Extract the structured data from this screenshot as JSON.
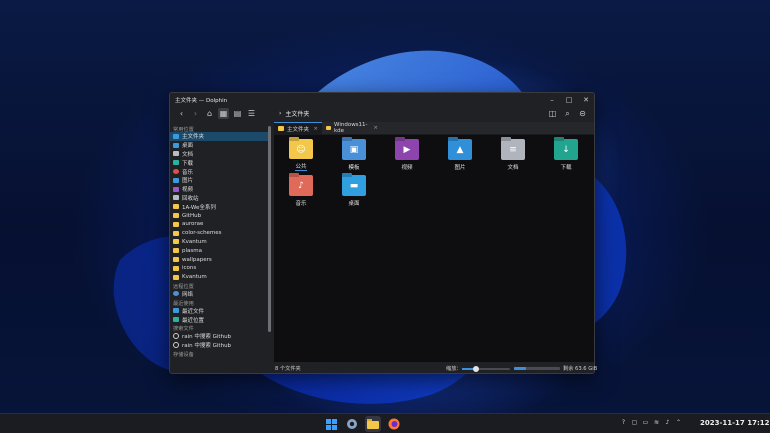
{
  "window": {
    "title": "主文件夹 — Dolphin",
    "breadcrumb": "主文件夹"
  },
  "sidebar": {
    "sections": [
      {
        "title": "常用位置",
        "items": [
          {
            "label": "主文件夹",
            "icon": "home-folder-icon",
            "selected": true
          },
          {
            "label": "桌面",
            "icon": "desktop-folder-icon"
          },
          {
            "label": "文档",
            "icon": "documents-folder-icon"
          },
          {
            "label": "下载",
            "icon": "downloads-folder-icon"
          },
          {
            "label": "音乐",
            "icon": "music-icon"
          },
          {
            "label": "图片",
            "icon": "pictures-icon"
          },
          {
            "label": "视频",
            "icon": "videos-icon"
          },
          {
            "label": "回收站",
            "icon": "trash-icon"
          },
          {
            "label": "1A-We全系列",
            "icon": "folder-icon"
          },
          {
            "label": "GitHub",
            "icon": "folder-icon"
          },
          {
            "label": "aurorae",
            "icon": "folder-icon"
          },
          {
            "label": "color-schemes",
            "icon": "folder-icon"
          },
          {
            "label": "Kvantum",
            "icon": "folder-icon"
          },
          {
            "label": "plasma",
            "icon": "folder-icon"
          },
          {
            "label": "wallpapers",
            "icon": "folder-icon"
          },
          {
            "label": "icons",
            "icon": "folder-icon"
          },
          {
            "label": "Kvantum",
            "icon": "folder-icon"
          }
        ]
      },
      {
        "title": "远程位置",
        "items": [
          {
            "label": "网络",
            "icon": "network-icon"
          }
        ]
      },
      {
        "title": "最近使用",
        "items": [
          {
            "label": "最近文件",
            "icon": "recent-files-icon"
          },
          {
            "label": "最近位置",
            "icon": "recent-locations-icon"
          }
        ]
      },
      {
        "title": "搜索文件",
        "items": [
          {
            "label": "rain 中搜索 Github",
            "icon": "search-icon"
          },
          {
            "label": "rain 中搜索 Github",
            "icon": "search-icon"
          }
        ]
      },
      {
        "title": "存储设备",
        "items": []
      }
    ]
  },
  "tabs": [
    {
      "label": "主文件夹",
      "active": true
    },
    {
      "label": "Windows11-kde",
      "active": false
    }
  ],
  "files": [
    {
      "label": "公共",
      "color": "#f3c74a",
      "glyph": "☺",
      "selected": true
    },
    {
      "label": "模板",
      "color": "#4a90d9",
      "glyph": "▣"
    },
    {
      "label": "视频",
      "color": "#8e44ad",
      "glyph": "▶"
    },
    {
      "label": "图片",
      "color": "#2f8fd8",
      "glyph": "▲"
    },
    {
      "label": "文档",
      "color": "#b0b5bd",
      "glyph": "≡"
    },
    {
      "label": "下载",
      "color": "#22a58f",
      "glyph": "↓"
    },
    {
      "label": "音乐",
      "color": "#e06a5a",
      "glyph": "♪"
    },
    {
      "label": "桌面",
      "color": "#2f9fe0",
      "glyph": "▬"
    }
  ],
  "status": {
    "count": "8 个文件夹",
    "zoom_label": "缩放：",
    "zoom_level": 0.3,
    "free_fraction": 0.25,
    "free_label": "剩余 63.6 GiB"
  },
  "taskbar": {
    "clock": "2023-11-17 17:12"
  }
}
